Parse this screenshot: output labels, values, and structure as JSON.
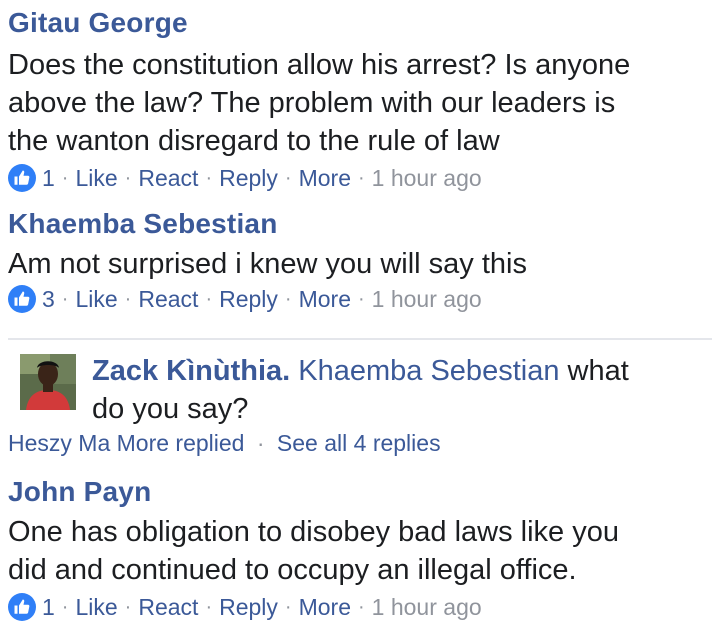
{
  "comments": [
    {
      "author": "Gitau George",
      "text_lines": [
        "Does the constitution allow his arrest? Is anyone",
        "above the law? The problem with our leaders is",
        "the wanton disregard to the rule of law"
      ],
      "likes": "1",
      "like": "Like",
      "react": "React",
      "reply": "Reply",
      "more": "More",
      "time": "1 hour ago"
    },
    {
      "author": "Khaemba Sebestian",
      "text_lines": [
        "Am not surprised i knew you will say this"
      ],
      "likes": "3",
      "like": "Like",
      "react": "React",
      "reply": "Reply",
      "more": "More",
      "time": "1 hour ago"
    },
    {
      "author": "John Payn",
      "text_lines": [
        "One has obligation to disobey bad laws like you",
        "did and continued to occupy an illegal office."
      ],
      "likes": "1",
      "like": "Like",
      "react": "React",
      "reply": "Reply",
      "more": "More",
      "time": "1 hour ago"
    }
  ],
  "reply_preview": {
    "author": "Zack Kìnùthia.",
    "mention": "Khaemba Sebestian",
    "text_line1_tail": "what",
    "text_line2": "do you say?",
    "replied_by": "Heszy Ma More replied",
    "see_all": "See all 4 replies"
  },
  "icons": {
    "like_badge": "thumbs-up-icon",
    "avatar": "user-avatar"
  },
  "colors": {
    "link": "#3b5998",
    "muted": "#90949c",
    "like_badge": "#2f7ff7",
    "text": "#1c1e21"
  }
}
